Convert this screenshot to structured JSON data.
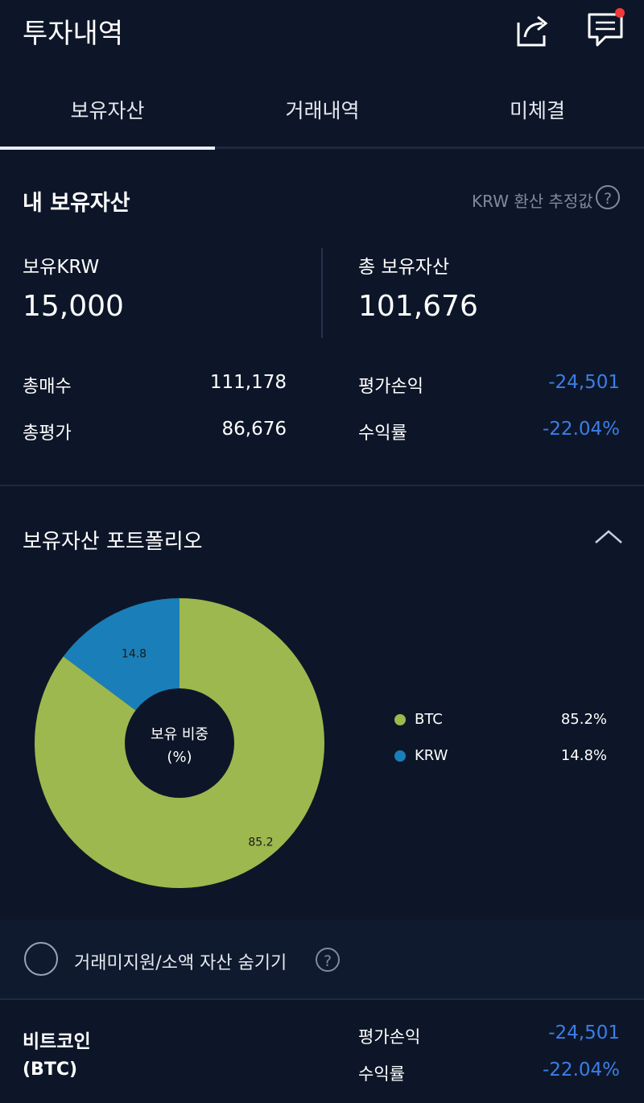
{
  "header": {
    "title": "투자내역"
  },
  "icons": {
    "share": "share-icon",
    "chat": "chat-icon"
  },
  "colors": {
    "background": "#0d1628",
    "negative": "#3b7ee8",
    "btc": "#9db84e",
    "krw": "#1a7fb8",
    "notification": "#f03a3a"
  },
  "tabs": [
    {
      "label": "보유자산",
      "active": true
    },
    {
      "label": "거래내역",
      "active": false
    },
    {
      "label": "미체결",
      "active": false
    }
  ],
  "assets": {
    "title": "내 보유자산",
    "note": "KRW 환산 추정값",
    "help": "?",
    "held_krw_label": "보유KRW",
    "held_krw_value": "15,000",
    "total_label": "총 보유자산",
    "total_value": "101,676",
    "total_buy_label": "총매수",
    "total_buy_value": "111,178",
    "total_eval_label": "총평가",
    "total_eval_value": "86,676",
    "pl_label": "평가손익",
    "pl_value": "-24,501",
    "return_label": "수익률",
    "return_value": "-22.04%"
  },
  "portfolio": {
    "title": "보유자산 포트폴리오",
    "center_line1": "보유 비중",
    "center_line2": "(%)"
  },
  "chart_data": {
    "type": "pie",
    "categories": [
      "BTC",
      "KRW"
    ],
    "values": [
      85.2,
      14.8
    ],
    "slice_labels": [
      "85.2",
      "14.8"
    ],
    "legend": [
      {
        "name": "BTC",
        "pct": "85.2%"
      },
      {
        "name": "KRW",
        "pct": "14.8%"
      }
    ],
    "legend_position": "right"
  },
  "hide_small": {
    "label": "거래미지원/소액 자산 숨기기",
    "help": "?"
  },
  "coin": {
    "name": "비트코인",
    "symbol": "(BTC)",
    "pl_label": "평가손익",
    "pl_value": "-24,501",
    "return_label": "수익률",
    "return_value": "-22.04%"
  }
}
